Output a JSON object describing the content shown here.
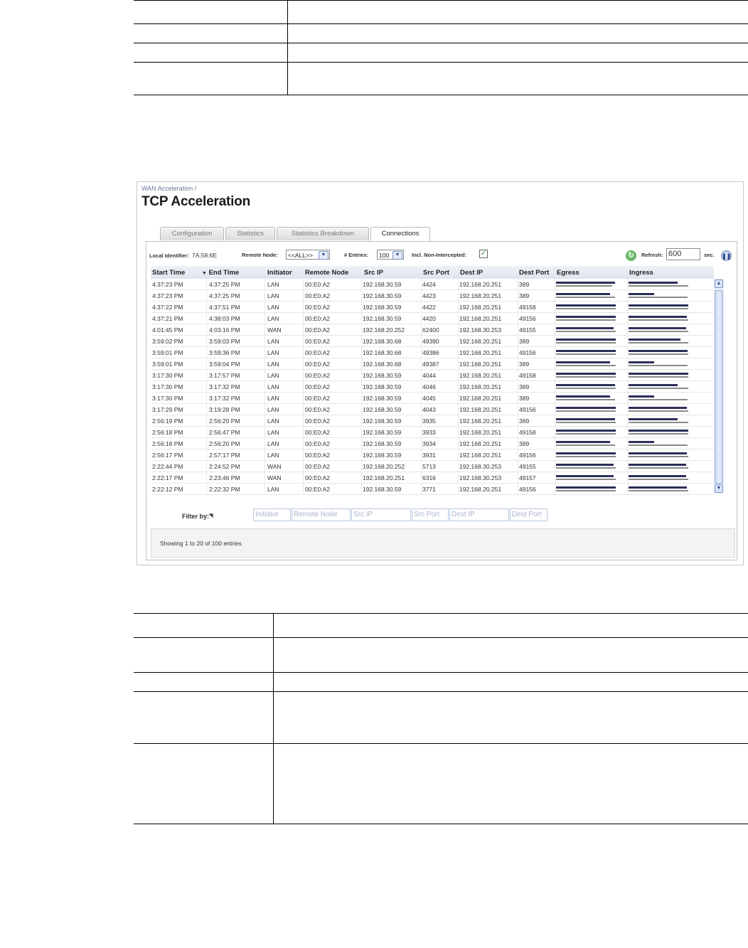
{
  "breadcrumb": "WAN Acceleration /",
  "page_title": "TCP Acceleration",
  "tabs": [
    {
      "label": "Configuration",
      "active": false
    },
    {
      "label": "Statistics",
      "active": false
    },
    {
      "label": "Statistics Breakdown",
      "active": false
    },
    {
      "label": "Connections",
      "active": true
    }
  ],
  "controls": {
    "local_identifier_label": "Local Identifier:",
    "local_identifier_value": "7A:58:6E",
    "remote_node_label": "Remote Node:",
    "remote_node_value": "<<ALL>>",
    "entries_label": "# Entries:",
    "entries_value": "100",
    "non_intercepted_label": "Incl. Non-Intercepted:",
    "non_intercepted_checked": true,
    "refresh_label": "Refresh:",
    "refresh_value": "600",
    "refresh_unit": "sec."
  },
  "columns": [
    "Start Time",
    "End Time",
    "Initiator",
    "Remote Node",
    "Src IP",
    "Src Port",
    "Dest IP",
    "Dest Port",
    "Egress",
    "Ingress"
  ],
  "sort_indicator": "▼",
  "rows": [
    {
      "start": "4:37:23 PM",
      "end": "4:37:25 PM",
      "init": "LAN",
      "node": "00:E0:A2",
      "src_ip": "192.168.30.59",
      "src_port": "4424",
      "dest_ip": "192.168.20.251",
      "dest_port": "389",
      "eg": [
        0.96,
        0.92
      ],
      "in": [
        0.8,
        0.98
      ]
    },
    {
      "start": "4:37:23 PM",
      "end": "4:37:25 PM",
      "init": "LAN",
      "node": "00:E0:A2",
      "src_ip": "192.168.30.59",
      "src_port": "4423",
      "dest_ip": "192.168.20.251",
      "dest_port": "389",
      "eg": [
        0.88,
        0.96
      ],
      "in": [
        0.42,
        0.96
      ]
    },
    {
      "start": "4:37:22 PM",
      "end": "4:37:51 PM",
      "init": "LAN",
      "node": "00:E0:A2",
      "src_ip": "192.168.30.59",
      "src_port": "4422",
      "dest_ip": "192.168.20.251",
      "dest_port": "49158",
      "eg": [
        0.98,
        0.98
      ],
      "in": [
        0.98,
        0.98
      ]
    },
    {
      "start": "4:37:21 PM",
      "end": "4:38:03 PM",
      "init": "LAN",
      "node": "00:E0:A2",
      "src_ip": "192.168.30.59",
      "src_port": "4420",
      "dest_ip": "192.168.20.251",
      "dest_port": "49156",
      "eg": [
        0.98,
        0.98
      ],
      "in": [
        0.95,
        0.98
      ]
    },
    {
      "start": "4:01:45 PM",
      "end": "4:03:16 PM",
      "init": "WAN",
      "node": "00:E0:A2",
      "src_ip": "192.168.20.252",
      "src_port": "62400",
      "dest_ip": "192.168.30.253",
      "dest_port": "49155",
      "eg": [
        0.94,
        0.98
      ],
      "in": [
        0.94,
        0.98
      ]
    },
    {
      "start": "3:59:02 PM",
      "end": "3:59:03 PM",
      "init": "LAN",
      "node": "00:E0:A2",
      "src_ip": "192.168.30.68",
      "src_port": "49390",
      "dest_ip": "192.168.20.251",
      "dest_port": "389",
      "eg": [
        0.98,
        0.98
      ],
      "in": [
        0.85,
        0.98
      ]
    },
    {
      "start": "3:59:01 PM",
      "end": "3:59:36 PM",
      "init": "LAN",
      "node": "00:E0:A2",
      "src_ip": "192.168.30.68",
      "src_port": "49386",
      "dest_ip": "192.168.20.251",
      "dest_port": "49156",
      "eg": [
        0.98,
        0.98
      ],
      "in": [
        0.96,
        0.98
      ]
    },
    {
      "start": "3:59:01 PM",
      "end": "3:59:04 PM",
      "init": "LAN",
      "node": "00:E0:A2",
      "src_ip": "192.168.30.68",
      "src_port": "49387",
      "dest_ip": "192.168.20.251",
      "dest_port": "389",
      "eg": [
        0.88,
        0.98
      ],
      "in": [
        0.42,
        0.96
      ]
    },
    {
      "start": "3:17:30 PM",
      "end": "3:17:57 PM",
      "init": "LAN",
      "node": "00:E0:A2",
      "src_ip": "192.168.30.59",
      "src_port": "4044",
      "dest_ip": "192.168.20.251",
      "dest_port": "49158",
      "eg": [
        0.98,
        0.98
      ],
      "in": [
        0.98,
        0.98
      ]
    },
    {
      "start": "3:17:30 PM",
      "end": "3:17:32 PM",
      "init": "LAN",
      "node": "00:E0:A2",
      "src_ip": "192.168.30.59",
      "src_port": "4046",
      "dest_ip": "192.168.20.251",
      "dest_port": "389",
      "eg": [
        0.96,
        0.98
      ],
      "in": [
        0.8,
        0.98
      ]
    },
    {
      "start": "3:17:30 PM",
      "end": "3:17:32 PM",
      "init": "LAN",
      "node": "00:E0:A2",
      "src_ip": "192.168.30.59",
      "src_port": "4045",
      "dest_ip": "192.168.20.251",
      "dest_port": "389",
      "eg": [
        0.88,
        0.96
      ],
      "in": [
        0.42,
        0.96
      ]
    },
    {
      "start": "3:17:29 PM",
      "end": "3:19:28 PM",
      "init": "LAN",
      "node": "00:E0:A2",
      "src_ip": "192.168.30.59",
      "src_port": "4043",
      "dest_ip": "192.168.20.251",
      "dest_port": "49156",
      "eg": [
        0.98,
        0.98
      ],
      "in": [
        0.95,
        0.98
      ]
    },
    {
      "start": "2:56:19 PM",
      "end": "2:56:20 PM",
      "init": "LAN",
      "node": "00:E0:A2",
      "src_ip": "192.168.30.59",
      "src_port": "3935",
      "dest_ip": "192.168.20.251",
      "dest_port": "389",
      "eg": [
        0.96,
        0.98
      ],
      "in": [
        0.8,
        0.98
      ]
    },
    {
      "start": "2:56:18 PM",
      "end": "2:56:47 PM",
      "init": "LAN",
      "node": "00:E0:A2",
      "src_ip": "192.168.30.59",
      "src_port": "3933",
      "dest_ip": "192.168.20.251",
      "dest_port": "49158",
      "eg": [
        0.98,
        0.98
      ],
      "in": [
        0.98,
        0.98
      ]
    },
    {
      "start": "2:56:18 PM",
      "end": "2:56:20 PM",
      "init": "LAN",
      "node": "00:E0:A2",
      "src_ip": "192.168.30.59",
      "src_port": "3934",
      "dest_ip": "192.168.20.251",
      "dest_port": "389",
      "eg": [
        0.88,
        0.96
      ],
      "in": [
        0.42,
        0.96
      ]
    },
    {
      "start": "2:56:17 PM",
      "end": "2:57:17 PM",
      "init": "LAN",
      "node": "00:E0:A2",
      "src_ip": "192.168.30.59",
      "src_port": "3931",
      "dest_ip": "192.168.20.251",
      "dest_port": "49156",
      "eg": [
        0.98,
        0.98
      ],
      "in": [
        0.95,
        0.98
      ]
    },
    {
      "start": "2:22:44 PM",
      "end": "2:24:52 PM",
      "init": "WAN",
      "node": "00:E0:A2",
      "src_ip": "192.168.20.252",
      "src_port": "5713",
      "dest_ip": "192.168.30.253",
      "dest_port": "49155",
      "eg": [
        0.94,
        0.98
      ],
      "in": [
        0.94,
        0.98
      ]
    },
    {
      "start": "2:22:17 PM",
      "end": "2:23:46 PM",
      "init": "WAN",
      "node": "00:E0:A2",
      "src_ip": "192.168.20.251",
      "src_port": "6316",
      "dest_ip": "192.168.30.253",
      "dest_port": "49157",
      "eg": [
        0.94,
        0.98
      ],
      "in": [
        0.94,
        0.98
      ]
    },
    {
      "start": "2:22:12 PM",
      "end": "2:22:32 PM",
      "init": "LAN",
      "node": "00:E0:A2",
      "src_ip": "192.168.30.59",
      "src_port": "3771",
      "dest_ip": "192.168.20.251",
      "dest_port": "49156",
      "eg": [
        0.98,
        0.98
      ],
      "in": [
        0.95,
        0.98
      ]
    }
  ],
  "filter": {
    "label": "Filter by:",
    "placeholders": [
      "Initiator",
      "Remote Node",
      "Src IP",
      "Src Port",
      "Dest IP",
      "Dest Port"
    ]
  },
  "footer_text": "Showing 1 to 20 of 100 entries",
  "colors": {
    "bar_dark": "#2b2f5a",
    "bar_gray": "#8a8a8a",
    "header_bg": "#dfe4ee"
  }
}
